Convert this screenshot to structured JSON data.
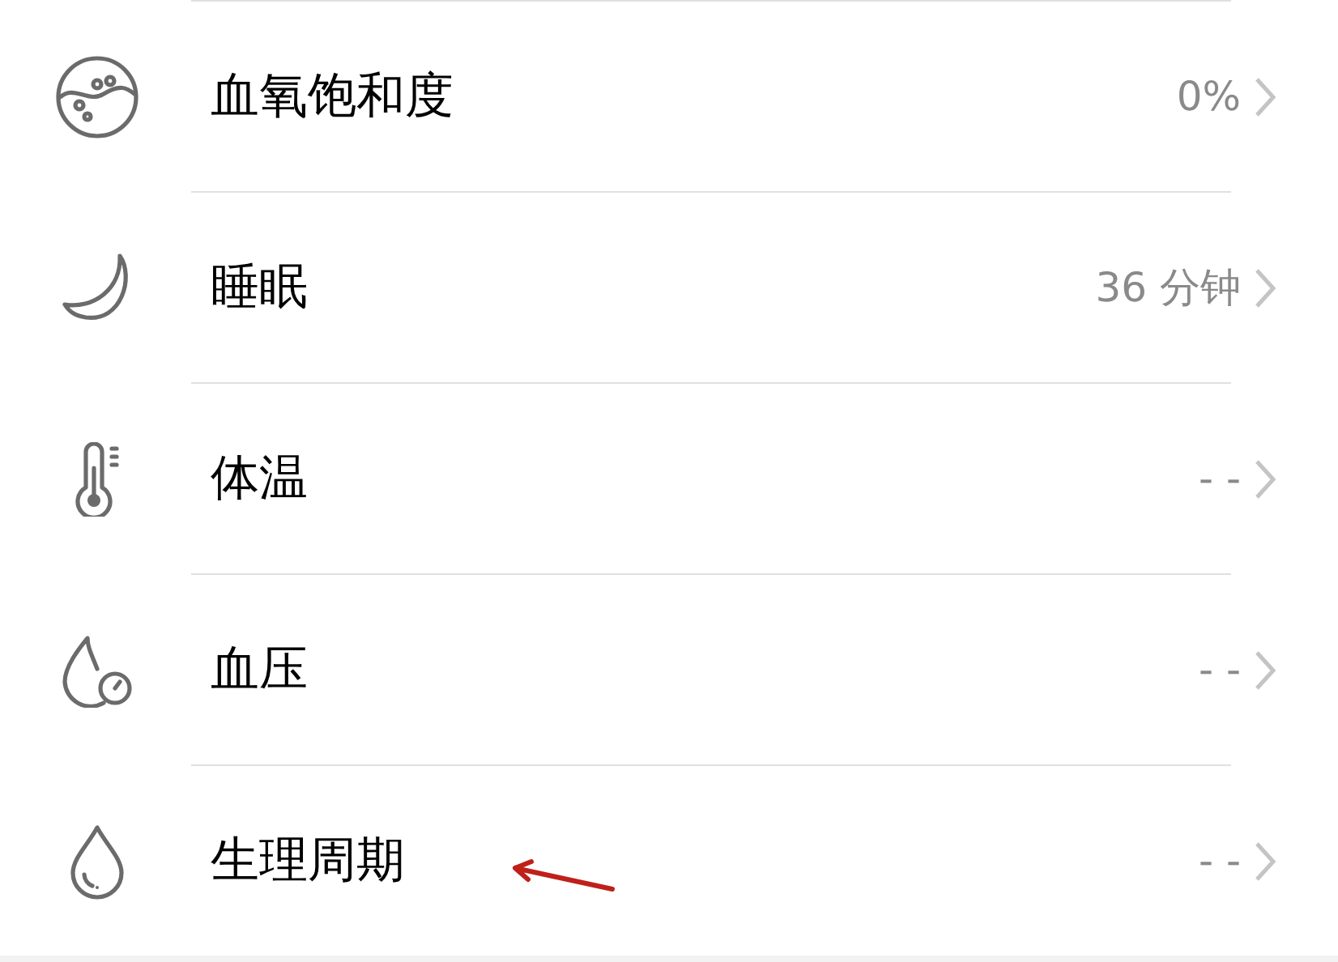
{
  "rows": [
    {
      "kind": "oxygen",
      "label": "血氧饱和度",
      "value": "0%"
    },
    {
      "kind": "sleep",
      "label": "睡眠",
      "value": "36 分钟"
    },
    {
      "kind": "temperature",
      "label": "体温",
      "value": "- -"
    },
    {
      "kind": "pressure",
      "label": "血压",
      "value": "- -"
    },
    {
      "kind": "cycle",
      "label": "生理周期",
      "value": "- -"
    }
  ]
}
